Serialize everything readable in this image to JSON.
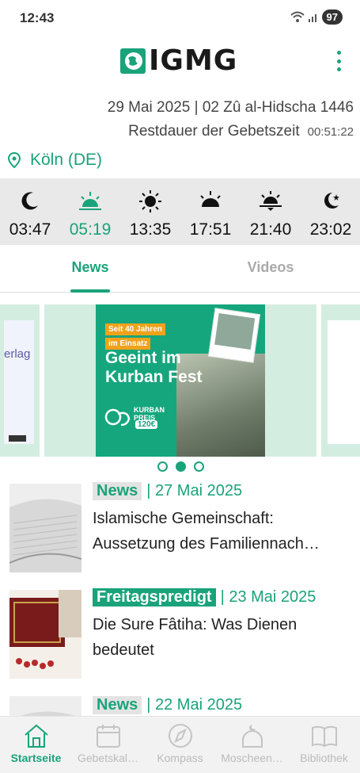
{
  "status": {
    "time": "12:43",
    "battery": "97"
  },
  "header": {
    "logo_text": "IGMG"
  },
  "prayer_info": {
    "date_line": "29 Mai 2025 | 02 Zû al-Hidscha 1446",
    "remaining_label": "Restdauer der Gebetszeit",
    "remaining_time": "00:51:22",
    "location": "Köln (DE)"
  },
  "prayer_times": [
    {
      "icon": "crescent-moon-icon",
      "time": "03:47",
      "active": false
    },
    {
      "icon": "sunrise-icon",
      "time": "05:19",
      "active": true
    },
    {
      "icon": "sun-icon",
      "time": "13:35",
      "active": false
    },
    {
      "icon": "afternoon-sun-icon",
      "time": "17:51",
      "active": false
    },
    {
      "icon": "sunset-icon",
      "time": "21:40",
      "active": false
    },
    {
      "icon": "moon-star-icon",
      "time": "23:02",
      "active": false
    }
  ],
  "tabs": [
    {
      "label": "News",
      "active": true
    },
    {
      "label": "Videos",
      "active": false
    }
  ],
  "carousel": {
    "left_card_text": "erlag",
    "banner": {
      "tag_line_1": "Seit 40 Jahren",
      "tag_line_2": "im Einsatz",
      "title_line_1": "Geeint im",
      "title_line_2": "Kurban Fest",
      "badge_line_1": "KURBAN",
      "badge_line_2": "PREIS",
      "badge_number": "120€"
    },
    "active_index": 1,
    "count": 3
  },
  "news": [
    {
      "category": "News",
      "category_style": "light",
      "date": "| 27 Mai 2025",
      "title_line_1": "Islamische Gemeinschaft:",
      "title_line_2": "Aussetzung des Familiennach…",
      "thumb": "newspaper"
    },
    {
      "category": "Freitagspredigt",
      "category_style": "solid",
      "date": "| 23 Mai 2025",
      "title_line_1": "Die Sure Fâtiha: Was Dienen",
      "title_line_2": "bedeutet",
      "thumb": "quran"
    },
    {
      "category": "News",
      "category_style": "light",
      "date": "| 22 Mai 2025",
      "title_line_1": "",
      "title_line_2": "",
      "thumb": "newspaper"
    }
  ],
  "bottom_nav": [
    {
      "label": "Startseite",
      "icon": "home-icon",
      "active": true
    },
    {
      "label": "Gebetskal…",
      "icon": "calendar-icon",
      "active": false
    },
    {
      "label": "Kompass",
      "icon": "compass-icon",
      "active": false
    },
    {
      "label": "Moscheen…",
      "icon": "mosque-icon",
      "active": false
    },
    {
      "label": "Bibliothek",
      "icon": "book-icon",
      "active": false
    }
  ],
  "colors": {
    "accent": "#1aa37a",
    "banner": "#15a67d",
    "strip": "#e9e9e9"
  }
}
